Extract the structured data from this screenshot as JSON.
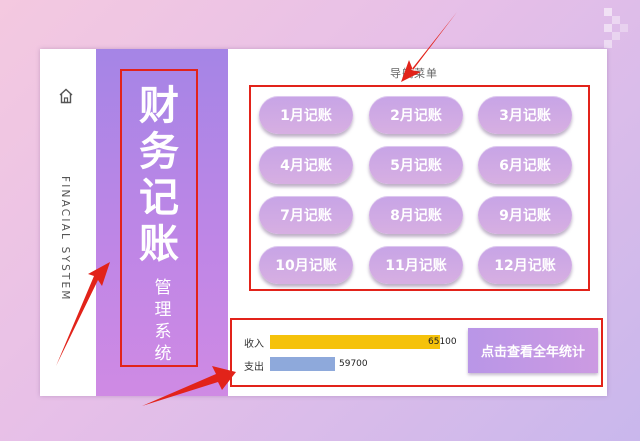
{
  "sidebar": {
    "home_icon": "home-icon",
    "vertical_text": "FINACIAL SYSTEM"
  },
  "banner": {
    "title_chars": [
      "财",
      "务",
      "记",
      "账"
    ],
    "subtitle_chars": [
      "管",
      "理",
      "系",
      "统"
    ]
  },
  "nav": {
    "title": "导航菜单",
    "months": [
      "1月记账",
      "2月记账",
      "3月记账",
      "4月记账",
      "5月记账",
      "6月记账",
      "7月记账",
      "8月记账",
      "9月记账",
      "10月记账",
      "11月记账",
      "12月记账"
    ]
  },
  "stats": {
    "income_label": "收入",
    "income_value": 65100,
    "income_value_text": "65100",
    "expense_label": "支出",
    "expense_value": 59700,
    "expense_value_text": "59700",
    "income_color": "#f5c20b",
    "expense_color": "#8ea9db",
    "year_button": "点击查看全年统计"
  },
  "colors": {
    "annotation_red": "#e2231a",
    "banner_purple": "#b286e6",
    "button_purple": "#c9a5e5"
  }
}
